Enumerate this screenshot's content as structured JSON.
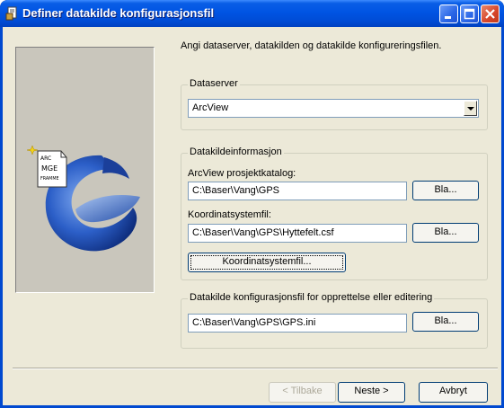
{
  "window": {
    "title": "Definer datakilde konfigurasjonsfil"
  },
  "intro": "Angi dataserver, datakilden og datakilde konfigureringsfilen.",
  "dataserver": {
    "legend": "Dataserver",
    "selected": "ArcView"
  },
  "info": {
    "legend": "Datakildeinformasjon",
    "project_label": "ArcView prosjektkatalog:",
    "project_value": "C:\\Baser\\Vang\\GPS",
    "coord_label": "Koordinatsystemfil:",
    "coord_value": "C:\\Baser\\Vang\\GPS\\Hyttefelt.csf",
    "coord_button": "Koordinatsystemfil...",
    "browse_label": "Bla..."
  },
  "config": {
    "legend": "Datakilde konfigurasjonsfil for opprettelse eller editering",
    "value": "C:\\Baser\\Vang\\GPS\\GPS.ini",
    "browse_label": "Bla..."
  },
  "art": {
    "document_lines": [
      "ARC",
      "MGE",
      "FRAMME"
    ]
  },
  "footer": {
    "back": "< Tilbake",
    "next": "Neste >",
    "cancel": "Avbryt"
  },
  "colors": {
    "titlebar": "#0054e3",
    "client": "#ece9d8",
    "close": "#d6452a"
  }
}
